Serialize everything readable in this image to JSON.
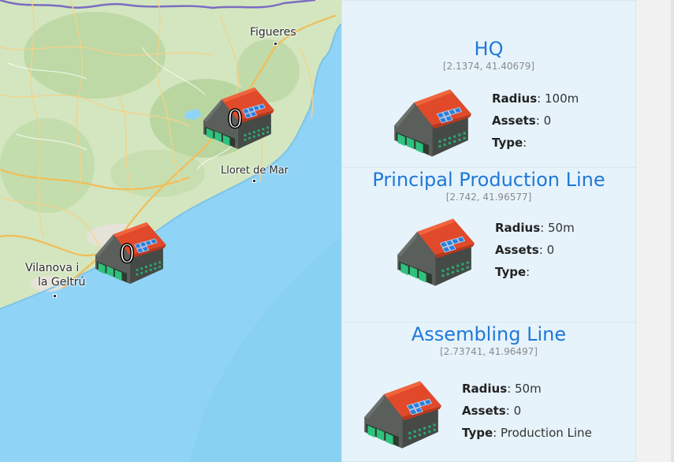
{
  "map": {
    "labels": {
      "figueres": "Figueres",
      "lloret": "Lloret de Mar",
      "vilanova_line1": "Vilanova i",
      "vilanova_line2": "la Geltrú"
    },
    "markers": [
      {
        "count": "0",
        "icon": "factory-icon"
      },
      {
        "count": "0",
        "icon": "factory-icon"
      }
    ],
    "colors": {
      "sea": "#8fd4f6",
      "land": "#d6e8c4",
      "road": "#f4c76a",
      "border": "#6e5ab0"
    }
  },
  "sites": [
    {
      "title": "HQ",
      "coords": "[2.1374, 41.40679]",
      "radius_label": "Radius",
      "radius_value": ": 100m",
      "assets_label": "Assets",
      "assets_value": ": 0",
      "type_label": "Type",
      "type_value": ":",
      "icon": "factory-icon"
    },
    {
      "title": "Principal Production Line",
      "coords": "[2.742, 41.96577]",
      "radius_label": "Radius",
      "radius_value": ": 50m",
      "assets_label": "Assets",
      "assets_value": ": 0",
      "type_label": "Type",
      "type_value": ":",
      "icon": "factory-icon"
    },
    {
      "title": "Assembling Line",
      "coords": "[2.73741, 41.96497]",
      "radius_label": "Radius",
      "radius_value": ": 50m",
      "assets_label": "Assets",
      "assets_value": ": 0",
      "type_label": "Type",
      "type_value": ": Production Line",
      "icon": "factory-icon"
    }
  ],
  "colors": {
    "panel_bg": "#e6f3fb",
    "title": "#1f78d8",
    "coords": "#8a8a8a"
  }
}
